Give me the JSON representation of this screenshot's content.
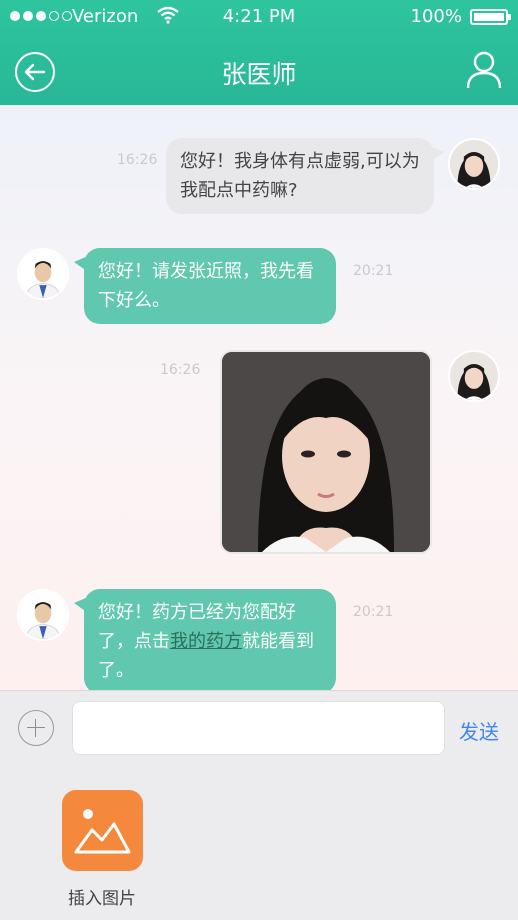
{
  "status_bar": {
    "carrier": "Verizon",
    "time": "4:21 PM",
    "battery": "100%"
  },
  "nav": {
    "title": "张医师"
  },
  "messages": [
    {
      "sender": "patient",
      "time": "16:26",
      "text": "您好！我身体有点虚弱,可以为我配点中药嘛?"
    },
    {
      "sender": "doctor",
      "time": "20:21",
      "text": "您好！请发张近照，我先看下好么。"
    },
    {
      "sender": "patient",
      "time": "16:26",
      "type": "image"
    },
    {
      "sender": "doctor",
      "time": "20:21",
      "text_before": "您好！药方已经为您配好了，点击",
      "link": "我的药方",
      "text_after": "就能看到了。"
    }
  ],
  "input_bar": {
    "placeholder": "",
    "send_label": "发送"
  },
  "attachments": {
    "insert_image_label": "插入图片"
  },
  "colors": {
    "brand_green": "#2ec59e",
    "doctor_bubble": "#5fc8ae",
    "patient_bubble": "#e8e8ea",
    "send_blue": "#3f87f5",
    "image_tile": "#f4883d"
  }
}
